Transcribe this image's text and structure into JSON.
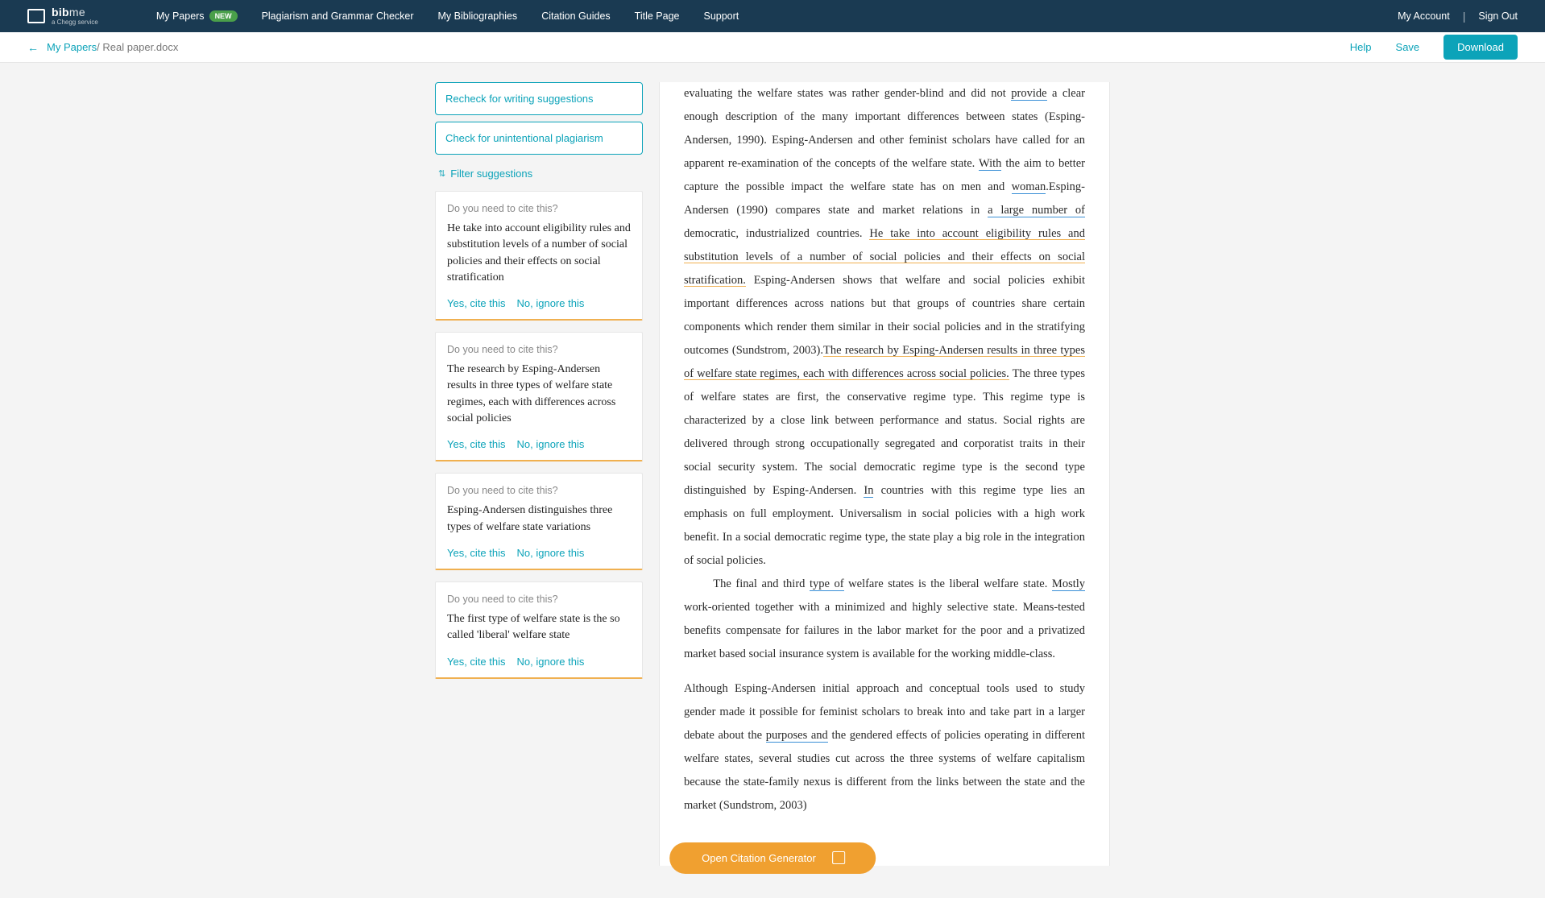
{
  "brand": {
    "name": "bib",
    "suffix": "me",
    "tagline": "a Chegg service"
  },
  "nav": {
    "my_papers": "My Papers",
    "new_badge": "NEW",
    "plagiarism": "Plagiarism and Grammar Checker",
    "biblios": "My Bibliographies",
    "guides": "Citation Guides",
    "title_page": "Title Page",
    "support": "Support",
    "account": "My Account",
    "signout": "Sign Out"
  },
  "subnav": {
    "back_parent": "My Papers",
    "current": "/ Real paper.docx",
    "help": "Help",
    "save": "Save",
    "download": "Download"
  },
  "sidebar": {
    "recheck": "Recheck for writing suggestions",
    "check_plag": "Check for unintentional plagiarism",
    "filter": "Filter suggestions",
    "cite_q": "Do you need to cite this?",
    "yes": "Yes, cite this",
    "no": "No, ignore this",
    "cards": [
      {
        "text": "He take into account eligibility rules and substitution levels of a number of social policies and their effects on social stratification"
      },
      {
        "text": "The research by Esping-Andersen results in three types of welfare state regimes, each with differences across social policies"
      },
      {
        "text": "Esping-Andersen distinguishes three types of welfare state variations"
      },
      {
        "text": "The first type of welfare state is the so called 'liberal' welfare state"
      }
    ]
  },
  "doc": {
    "p1a": "evaluating the welfare states was rather gender-blind and did not ",
    "p1_provide": "provide",
    "p1b": " a clear enough description of the many important differences between states (Esping-Andersen, 1990). Esping-Andersen and other feminist scholars have called for an apparent re-examination of the concepts of the welfare state. ",
    "p1_with": "With",
    "p1c": " the aim to better capture the possible impact the welfare state has on men and ",
    "p1_woman": "woman",
    "p1d": ".Esping-Andersen (1990) compares state and market relations in ",
    "p1_large": "a large number of",
    "p1e": " democratic, industrialized countries. ",
    "p1_cite1": "He take into account eligibility rules and substitution levels of a number of social policies and their effects on social stratification.",
    "p1f": " Esping-Andersen shows that welfare and social policies exhibit important differences across nations but that groups of countries share certain components which render them similar in their social policies and in the stratifying outcomes (Sundstrom, 2003).",
    "p1_cite2": "The research by Esping-Andersen results in three types of welfare state regimes, each with differences across social policies.",
    "p1g": " The three types of welfare states are first, the conservative regime type. This regime type is characterized by a close link between performance and status. Social rights are delivered through strong occupationally segregated and corporatist traits in their social security system. The social democratic regime type is the second type distinguished by Esping-Andersen. ",
    "p1_in": "In",
    "p1h": " countries with this regime type lies an emphasis on full employment. Universalism in social policies with a high work benefit. In a social democratic regime type, the state play a big role in the integration of social policies.",
    "p2a": "The final and third ",
    "p2_typeof": "type of",
    "p2b": " welfare states is the liberal welfare state. ",
    "p2_mostly": "Mostly",
    "p2c": " work-oriented together with a minimized and highly selective state. Means-tested benefits compensate for failures in the labor market for the poor and a privatized market based social insurance system is available for the working middle-class.",
    "p3a": "Although Esping-Andersen initial approach and conceptual tools used to study gender made it possible for feminist scholars to break into and take part in a larger debate about the ",
    "p3_purposes": "purposes and",
    "p3b": " the gendered effects of policies operating in different welfare states, several studies cut across the three systems of welfare capitalism because the state-family nexus is different from the links between the state and the market (Sundstrom, 2003)"
  },
  "cite_button": "Open Citation Generator"
}
